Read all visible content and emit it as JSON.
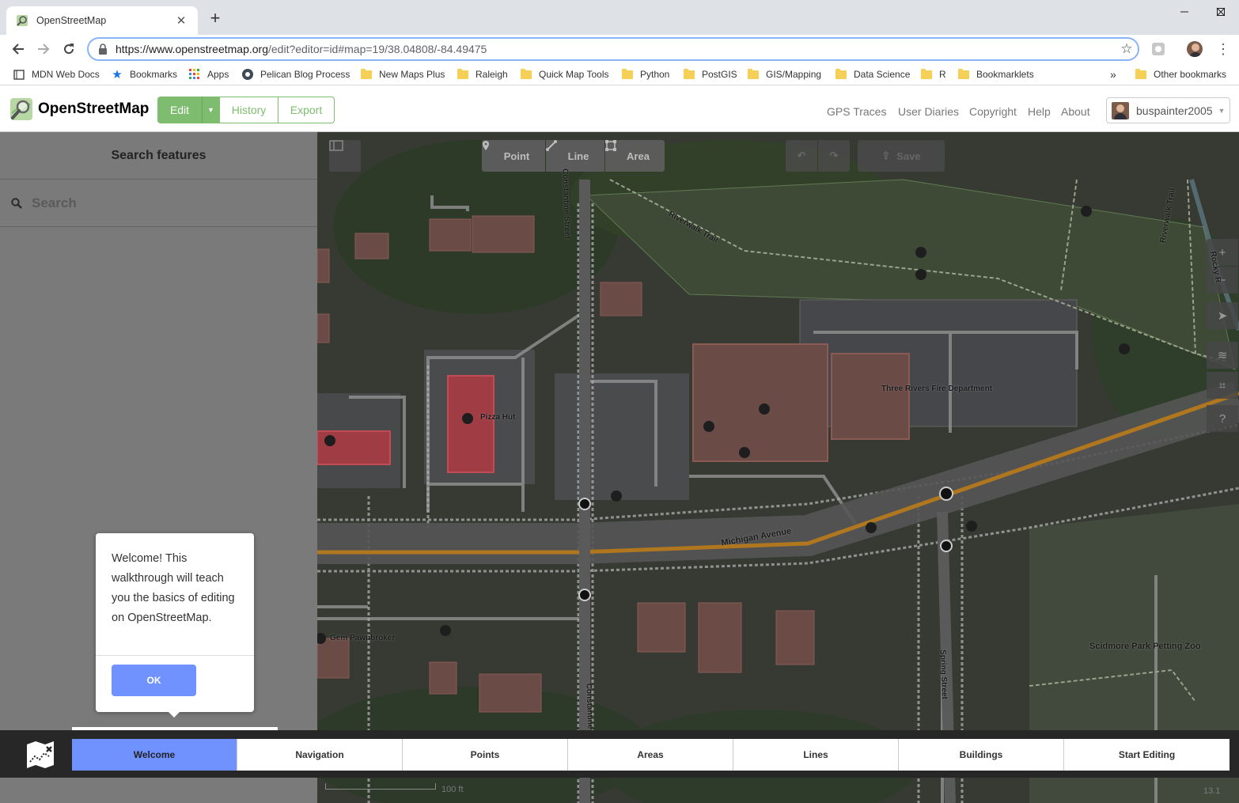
{
  "browser": {
    "tab": {
      "title": "OpenStreetMap",
      "close": "✕"
    },
    "new_tab": "+",
    "url": {
      "host": "https://www.openstreetmap.org",
      "path": "/edit?editor=id#map=19/38.04808/-84.49475"
    },
    "bookmarks": [
      {
        "label": "MDN Web Docs",
        "icon": "mdn-icon"
      },
      {
        "label": "Bookmarks",
        "icon": "star-icon"
      },
      {
        "label": "Apps",
        "icon": "apps-grid-icon"
      },
      {
        "label": "Pelican Blog Process",
        "icon": "pelican-icon"
      },
      {
        "label": "New Maps Plus",
        "icon": "folder-icon"
      },
      {
        "label": "Raleigh",
        "icon": "folder-icon"
      },
      {
        "label": "Quick Map Tools",
        "icon": "folder-icon"
      },
      {
        "label": "Python",
        "icon": "folder-icon"
      },
      {
        "label": "PostGIS",
        "icon": "folder-icon"
      },
      {
        "label": "GIS/Mapping",
        "icon": "folder-icon"
      },
      {
        "label": "Data Science",
        "icon": "folder-icon"
      },
      {
        "label": "R",
        "icon": "folder-icon"
      },
      {
        "label": "Bookmarklets",
        "icon": "folder-icon"
      }
    ],
    "overflow": "»",
    "other_bookmarks": "Other bookmarks"
  },
  "osm": {
    "brand": "OpenStreetMap",
    "edit": "Edit",
    "history": "History",
    "export": "Export",
    "nav": [
      "GPS Traces",
      "User Diaries",
      "Copyright",
      "Help",
      "About"
    ],
    "username": "buspainter2005"
  },
  "sidebar": {
    "header": "Search features",
    "search_placeholder": "Search"
  },
  "map": {
    "tools": {
      "point": "Point",
      "line": "Line",
      "area": "Area",
      "save": "Save"
    },
    "labels": {
      "riverwalk": "Riverwalk Trail",
      "riverwalk2": "Riverwalk Trail",
      "constantine_top": "Constantine Street",
      "constantine_bottom": "Constantine",
      "michigan": "Michigan Avenue",
      "spring": "Spring Street",
      "pizza": "Pizza Hut",
      "fire": "Three Rivers Fire Department",
      "pawn": "Gem Pawnbroker",
      "zoo": "Scidmore Park Petting Zoo",
      "rocky": "Rocky R"
    },
    "scale": "100 ft",
    "zoom": "13.1"
  },
  "walkthrough": {
    "message": "Welcome! This walkthrough will teach you the basics of editing on OpenStreetMap.",
    "ok": "OK",
    "tabs": [
      "Welcome",
      "Navigation",
      "Points",
      "Areas",
      "Lines",
      "Buildings",
      "Start Editing"
    ],
    "active": "Welcome"
  },
  "colors": {
    "osm_green": "#7ebc6f",
    "walkthrough_blue": "#7092ff",
    "omnibox_border": "#8ab4f8"
  }
}
